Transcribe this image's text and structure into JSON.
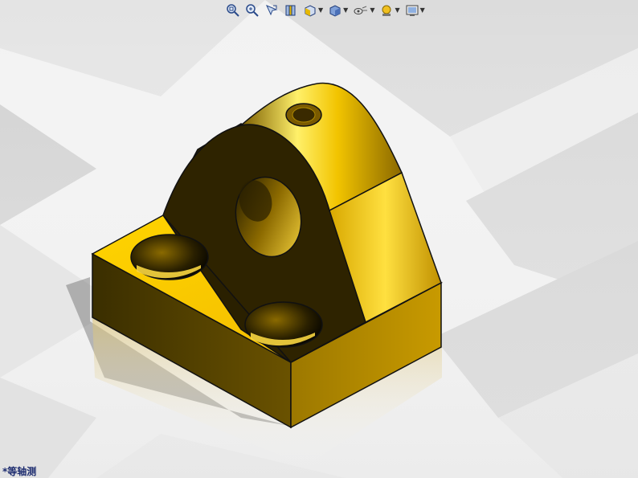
{
  "viewport": {
    "view_name": "*等轴测",
    "background_colors": [
      "#ffffff",
      "#d7d7d7"
    ],
    "model_color": "#e6b800"
  },
  "heads_up_toolbar": {
    "icons": [
      "zoom-to-fit-icon",
      "zoom-to-area-icon",
      "previous-view-icon",
      "section-view-icon",
      "view-orientation-icon",
      "display-style-icon",
      "hide-show-items-icon",
      "edit-appearance-icon",
      "apply-scene-icon"
    ]
  }
}
